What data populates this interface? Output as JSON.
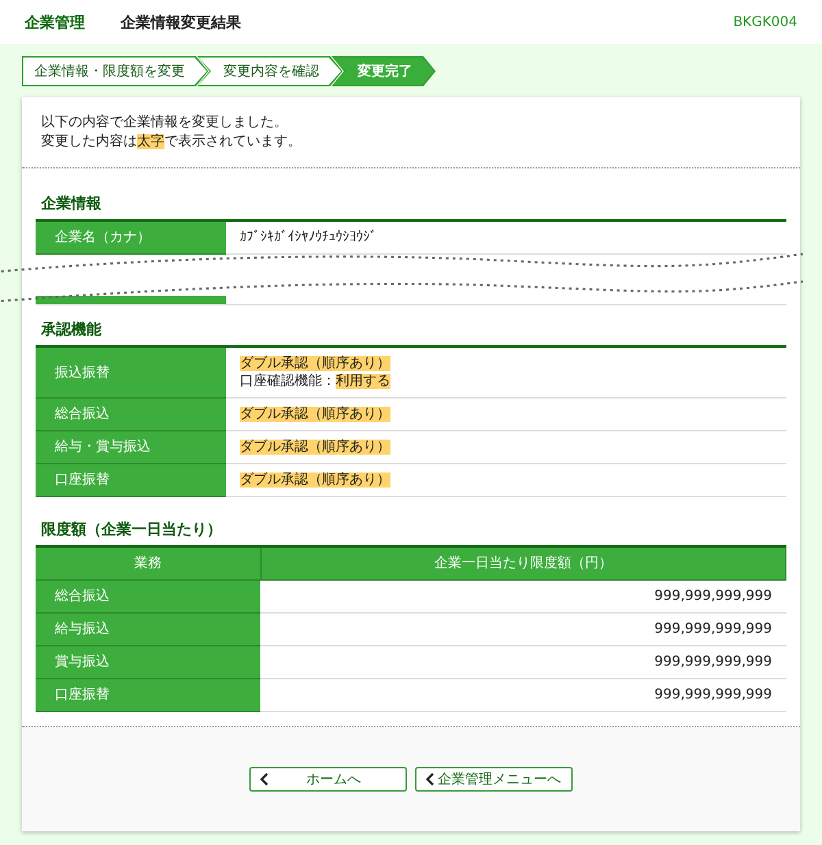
{
  "header": {
    "section": "企業管理",
    "title": "企業情報変更結果",
    "screen_id": "BKGK004"
  },
  "steps": [
    {
      "label": "企業情報・限度額を変更",
      "selected": false
    },
    {
      "label": "変更内容を確認",
      "selected": false
    },
    {
      "label": "変更完了",
      "selected": true
    }
  ],
  "message": [
    [
      {
        "text": "以下の内容で企業情報を変更しました。",
        "highlighted": false
      }
    ],
    [
      {
        "text": "変更した内容は",
        "highlighted": false
      },
      {
        "text": "太字",
        "highlighted": true
      },
      {
        "text": "で表示されています。",
        "highlighted": false
      }
    ]
  ],
  "company_info": {
    "heading": "企業情報",
    "rows": [
      {
        "label": "企業名（カナ）",
        "value": [
          [
            {
              "text": "ｶﾌﾞｼｷｶﾞｲｼﾔﾉｳﾁｭｳｼﾖｳｼﾞ",
              "highlighted": false
            }
          ]
        ]
      }
    ]
  },
  "approval": {
    "heading": "承認機能",
    "rows": [
      {
        "label": "振込振替",
        "value": [
          [
            {
              "text": "ダブル承認（順序あり）",
              "highlighted": true
            }
          ],
          [
            {
              "text": "口座確認機能：",
              "highlighted": false
            },
            {
              "text": "利用する",
              "highlighted": true
            }
          ]
        ]
      },
      {
        "label": "総合振込",
        "value": [
          [
            {
              "text": "ダブル承認（順序あり）",
              "highlighted": true
            }
          ]
        ]
      },
      {
        "label": "給与・賞与振込",
        "value": [
          [
            {
              "text": "ダブル承認（順序あり）",
              "highlighted": true
            }
          ]
        ]
      },
      {
        "label": "口座振替",
        "value": [
          [
            {
              "text": "ダブル承認（順序あり）",
              "highlighted": true
            }
          ]
        ]
      }
    ]
  },
  "limits": {
    "heading": "限度額（企業一日当たり）",
    "columns": [
      "業務",
      "企業一日当たり限度額（円）"
    ],
    "rows": [
      {
        "label": "総合振込",
        "amount": "999,999,999,999"
      },
      {
        "label": "給与振込",
        "amount": "999,999,999,999"
      },
      {
        "label": "賞与振込",
        "amount": "999,999,999,999"
      },
      {
        "label": "口座振替",
        "amount": "999,999,999,999"
      }
    ]
  },
  "buttons": [
    {
      "label": "ホームへ"
    },
    {
      "label": "企業管理メニューへ"
    }
  ]
}
